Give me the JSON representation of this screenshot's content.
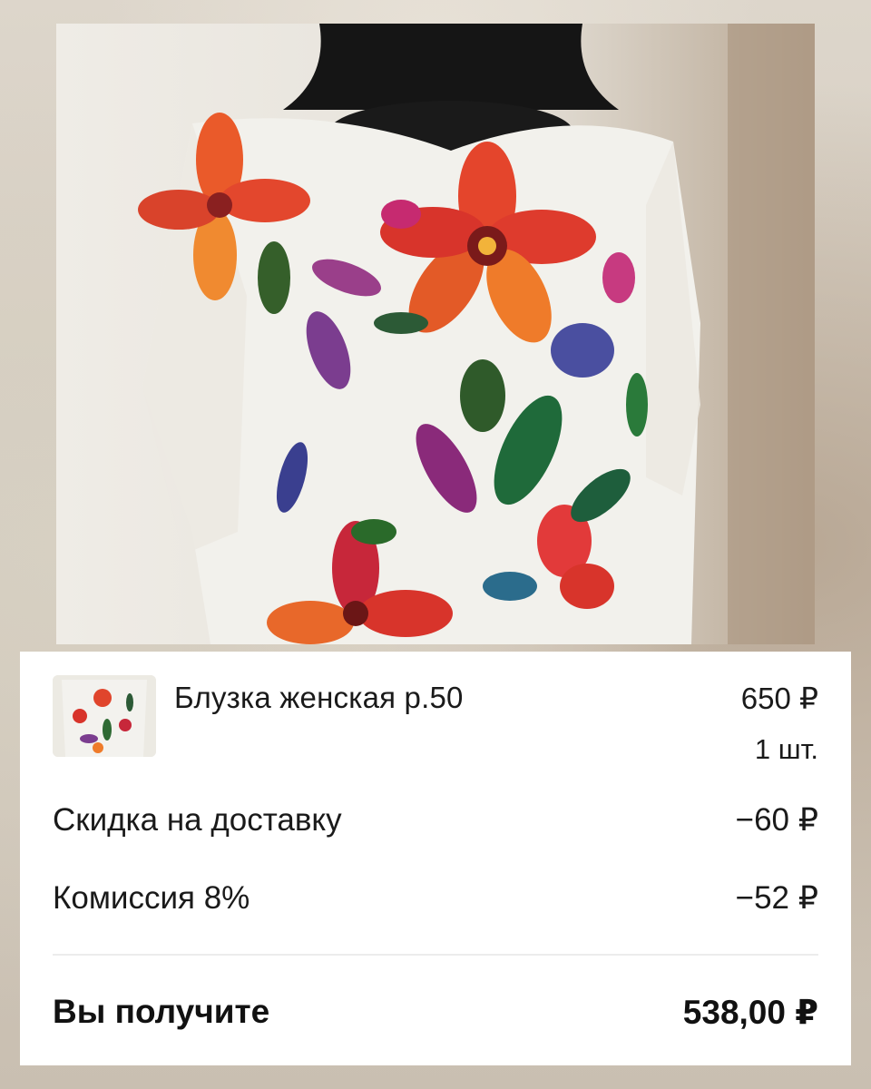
{
  "product": {
    "title": "Блузка женская р.50",
    "price": "650 ₽",
    "quantity": "1 шт."
  },
  "lines": {
    "discount_label": "Скидка на доставку",
    "discount_value": "−60 ₽",
    "commission_label": "Комиссия 8%",
    "commission_value": "−52 ₽"
  },
  "total": {
    "label": "Вы получите",
    "value": "538,00 ₽"
  },
  "colors": {
    "card_background": "#ffffff",
    "text": "#1a1a1a",
    "divider": "#ececec"
  }
}
